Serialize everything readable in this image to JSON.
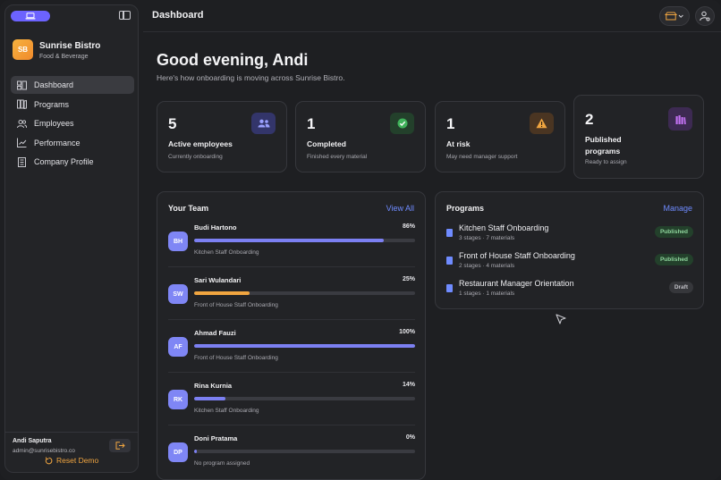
{
  "sidebar": {
    "brand": {
      "initials": "SB",
      "name": "Sunrise Bistro",
      "category": "Food & Beverage"
    },
    "nav": [
      {
        "label": "Dashboard",
        "icon": "dashboard-icon",
        "active": true
      },
      {
        "label": "Programs",
        "icon": "programs-icon",
        "active": false
      },
      {
        "label": "Employees",
        "icon": "employees-icon",
        "active": false
      },
      {
        "label": "Performance",
        "icon": "performance-icon",
        "active": false
      },
      {
        "label": "Company Profile",
        "icon": "company-profile-icon",
        "active": false
      }
    ],
    "user": {
      "name": "Andi Saputra",
      "email": "admin@sunrisebistro.co"
    },
    "reset_label": "Reset Demo"
  },
  "header": {
    "title": "Dashboard"
  },
  "greeting": {
    "title": "Good evening, Andi",
    "subtitle": "Here's how onboarding is moving across Sunrise Bistro."
  },
  "stats": [
    {
      "value": "5",
      "label": "Active employees",
      "desc": "Currently onboarding",
      "icon": "people-icon",
      "color": "#7f86f5"
    },
    {
      "value": "1",
      "label": "Completed",
      "desc": "Finished every material",
      "icon": "check-icon",
      "color": "#3fb25a"
    },
    {
      "value": "1",
      "label": "At risk",
      "desc": "May need manager support",
      "icon": "warning-icon",
      "color": "#f0a540"
    },
    {
      "value": "2",
      "label": "Published programs",
      "desc": "Ready to assign",
      "icon": "library-icon",
      "color": "#b05ce6"
    }
  ],
  "team": {
    "title": "Your Team",
    "link": "View All",
    "members": [
      {
        "initials": "BH",
        "name": "Budi Hartono",
        "percent_label": "86%",
        "progress": 0.86,
        "program": "Kitchen Staff Onboarding",
        "bar_color": "#7c80f2"
      },
      {
        "initials": "SW",
        "name": "Sari Wulandari",
        "percent_label": "25%",
        "progress": 0.25,
        "program": "Front of House Staff Onboarding",
        "bar_color": "#f0a540"
      },
      {
        "initials": "AF",
        "name": "Ahmad Fauzi",
        "percent_label": "100%",
        "progress": 1.0,
        "program": "Front of House Staff Onboarding",
        "bar_color": "#7c80f2"
      },
      {
        "initials": "RK",
        "name": "Rina Kurnia",
        "percent_label": "14%",
        "progress": 0.14,
        "program": "Kitchen Staff Onboarding",
        "bar_color": "#7c80f2"
      },
      {
        "initials": "DP",
        "name": "Doni Pratama",
        "percent_label": "0%",
        "progress": 0.0,
        "program": "No program assigned",
        "bar_color": "#7c80f2"
      }
    ]
  },
  "programs": {
    "title": "Programs",
    "link": "Manage",
    "items": [
      {
        "name": "Kitchen Staff Onboarding",
        "meta": "3 stages · 7 materials",
        "status": "Published"
      },
      {
        "name": "Front of House Staff Onboarding",
        "meta": "2 stages · 4 materials",
        "status": "Published"
      },
      {
        "name": "Restaurant Manager Orientation",
        "meta": "1 stages · 1 materials",
        "status": "Draft"
      }
    ]
  }
}
